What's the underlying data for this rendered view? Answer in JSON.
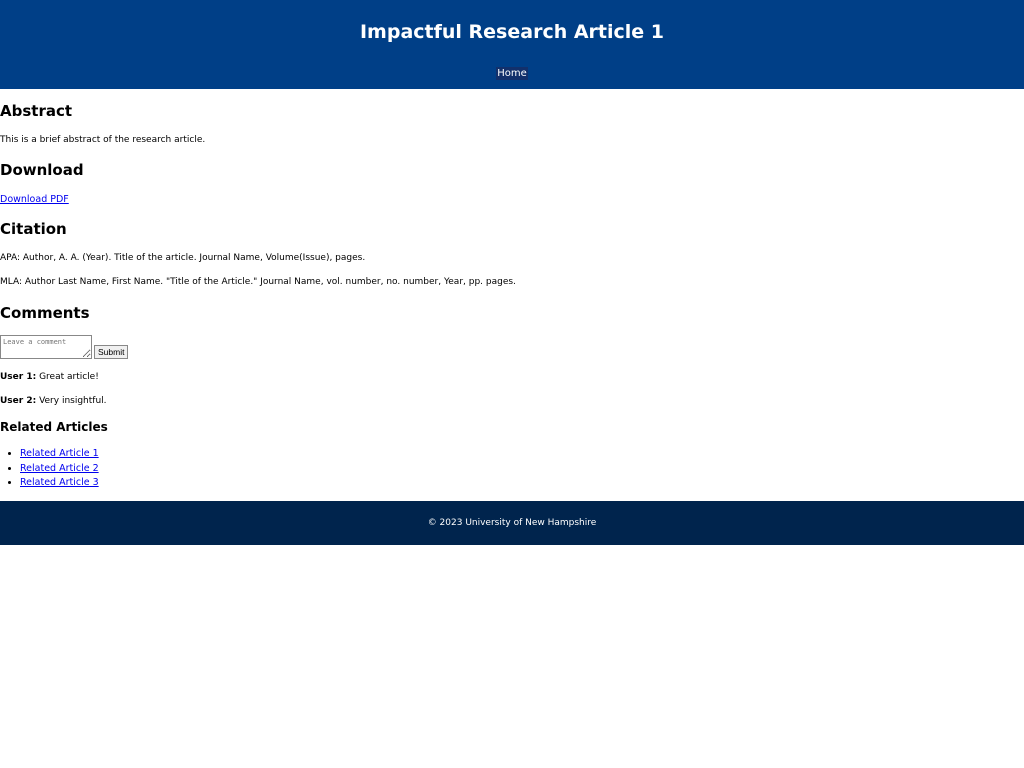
{
  "header": {
    "title": "Impactful Research Article 1",
    "nav": [
      "Home"
    ]
  },
  "abstract": {
    "heading": "Abstract",
    "text": "This is a brief abstract of the research article."
  },
  "download": {
    "heading": "Download",
    "link": "Download PDF"
  },
  "citation": {
    "heading": "Citation",
    "apa": "APA: Author, A. A. (Year). Title of the article. Journal Name, Volume(Issue), pages.",
    "mla": "MLA: Author Last Name, First Name. \"Title of the Article.\" Journal Name, vol. number, no. number, Year, pp. pages."
  },
  "comments": {
    "heading": "Comments",
    "placeholder": "Leave a comment",
    "submit": "Submit",
    "items": [
      {
        "user": "User 1:",
        "text": " Great article!"
      },
      {
        "user": "User 2:",
        "text": " Very insightful."
      }
    ]
  },
  "related": {
    "heading": "Related Articles",
    "items": [
      "Related Article 1",
      "Related Article 2",
      "Related Article 3"
    ]
  },
  "footer": {
    "text": "© 2023 University of New Hampshire"
  }
}
